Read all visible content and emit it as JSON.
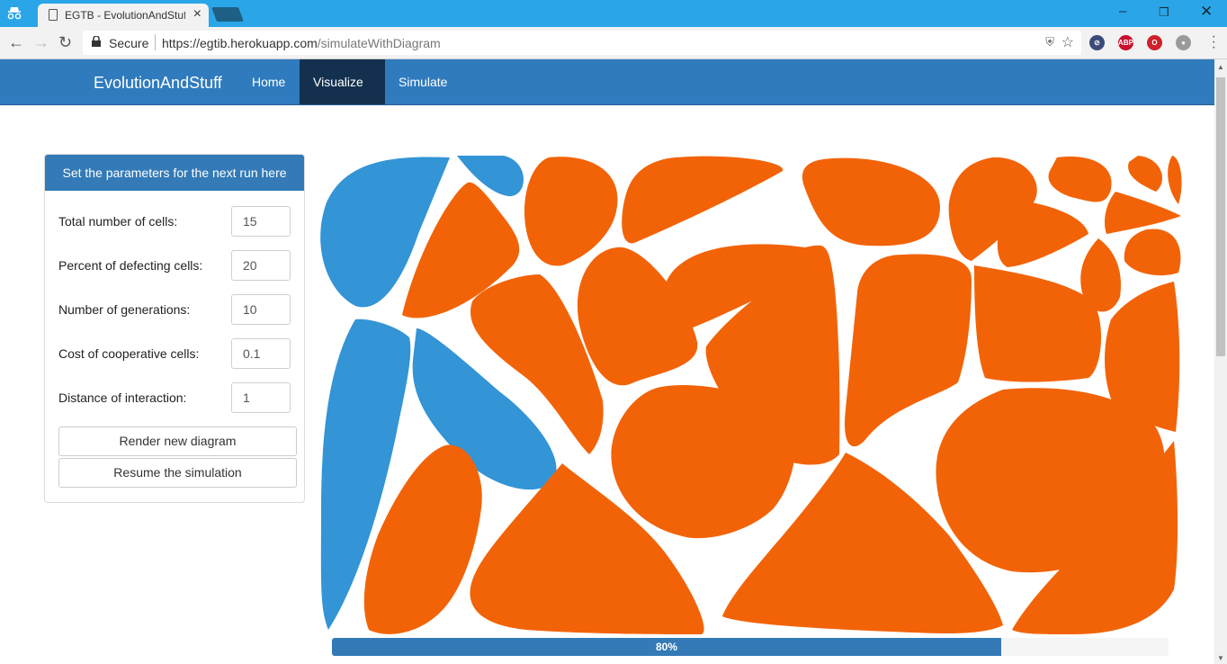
{
  "browser": {
    "tab_title": "EGTB - EvolutionAndStuf",
    "secure_label": "Secure",
    "url_host": "https://egtib.herokuapp.com",
    "url_path": "/simulateWithDiagram",
    "extensions": [
      {
        "name": "privacy-badger-icon",
        "color": "#3b4a7a",
        "text": ""
      },
      {
        "name": "adblock-plus-icon",
        "color": "#c8102e",
        "text": "ABP"
      },
      {
        "name": "opera-icon",
        "color": "#d0202a",
        "text": ""
      },
      {
        "name": "globe-icon",
        "color": "#9a9a9a",
        "text": ""
      }
    ]
  },
  "navbar": {
    "brand": "EvolutionAndStuff",
    "links": [
      {
        "label": "Home",
        "active": false
      },
      {
        "label": "Visualize",
        "active": true,
        "dropdown": true
      },
      {
        "label": "Simulate",
        "active": false
      }
    ]
  },
  "panel": {
    "heading": "Set the parameters for the next run here",
    "fields": [
      {
        "label": "Total number of cells:",
        "value": "15"
      },
      {
        "label": "Percent of defecting cells:",
        "value": "20"
      },
      {
        "label": "Number of generations:",
        "value": "10"
      },
      {
        "label": "Cost of cooperative cells:",
        "value": "0.1"
      },
      {
        "label": "Distance of interaction:",
        "value": "1"
      }
    ],
    "buttons": {
      "render": "Render new diagram",
      "resume": "Resume the simulation"
    }
  },
  "diagram": {
    "colors": {
      "cooperative": "#f26308",
      "defecting": "#3394d6"
    }
  },
  "progress": {
    "percent": 80,
    "label": "80%"
  }
}
